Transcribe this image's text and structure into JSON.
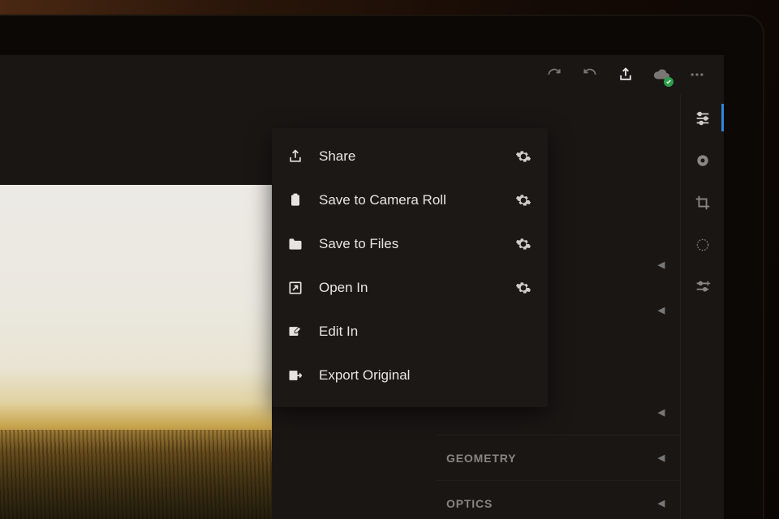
{
  "share_menu": {
    "items": [
      {
        "label": "Share",
        "icon": "share-icon",
        "has_settings": true
      },
      {
        "label": "Save to Camera Roll",
        "icon": "camera-roll-icon",
        "has_settings": true
      },
      {
        "label": "Save to Files",
        "icon": "folder-icon",
        "has_settings": true
      },
      {
        "label": "Open In",
        "icon": "open-in-icon",
        "has_settings": true
      },
      {
        "label": "Edit In",
        "icon": "edit-in-icon",
        "has_settings": false
      },
      {
        "label": "Export Original",
        "icon": "export-icon",
        "has_settings": false
      }
    ]
  },
  "panels": [
    {
      "label": "GEOMETRY"
    },
    {
      "label": "OPTICS"
    }
  ],
  "colors": {
    "accent": "#2f87d8",
    "sync_ok": "#2e9e4a"
  }
}
